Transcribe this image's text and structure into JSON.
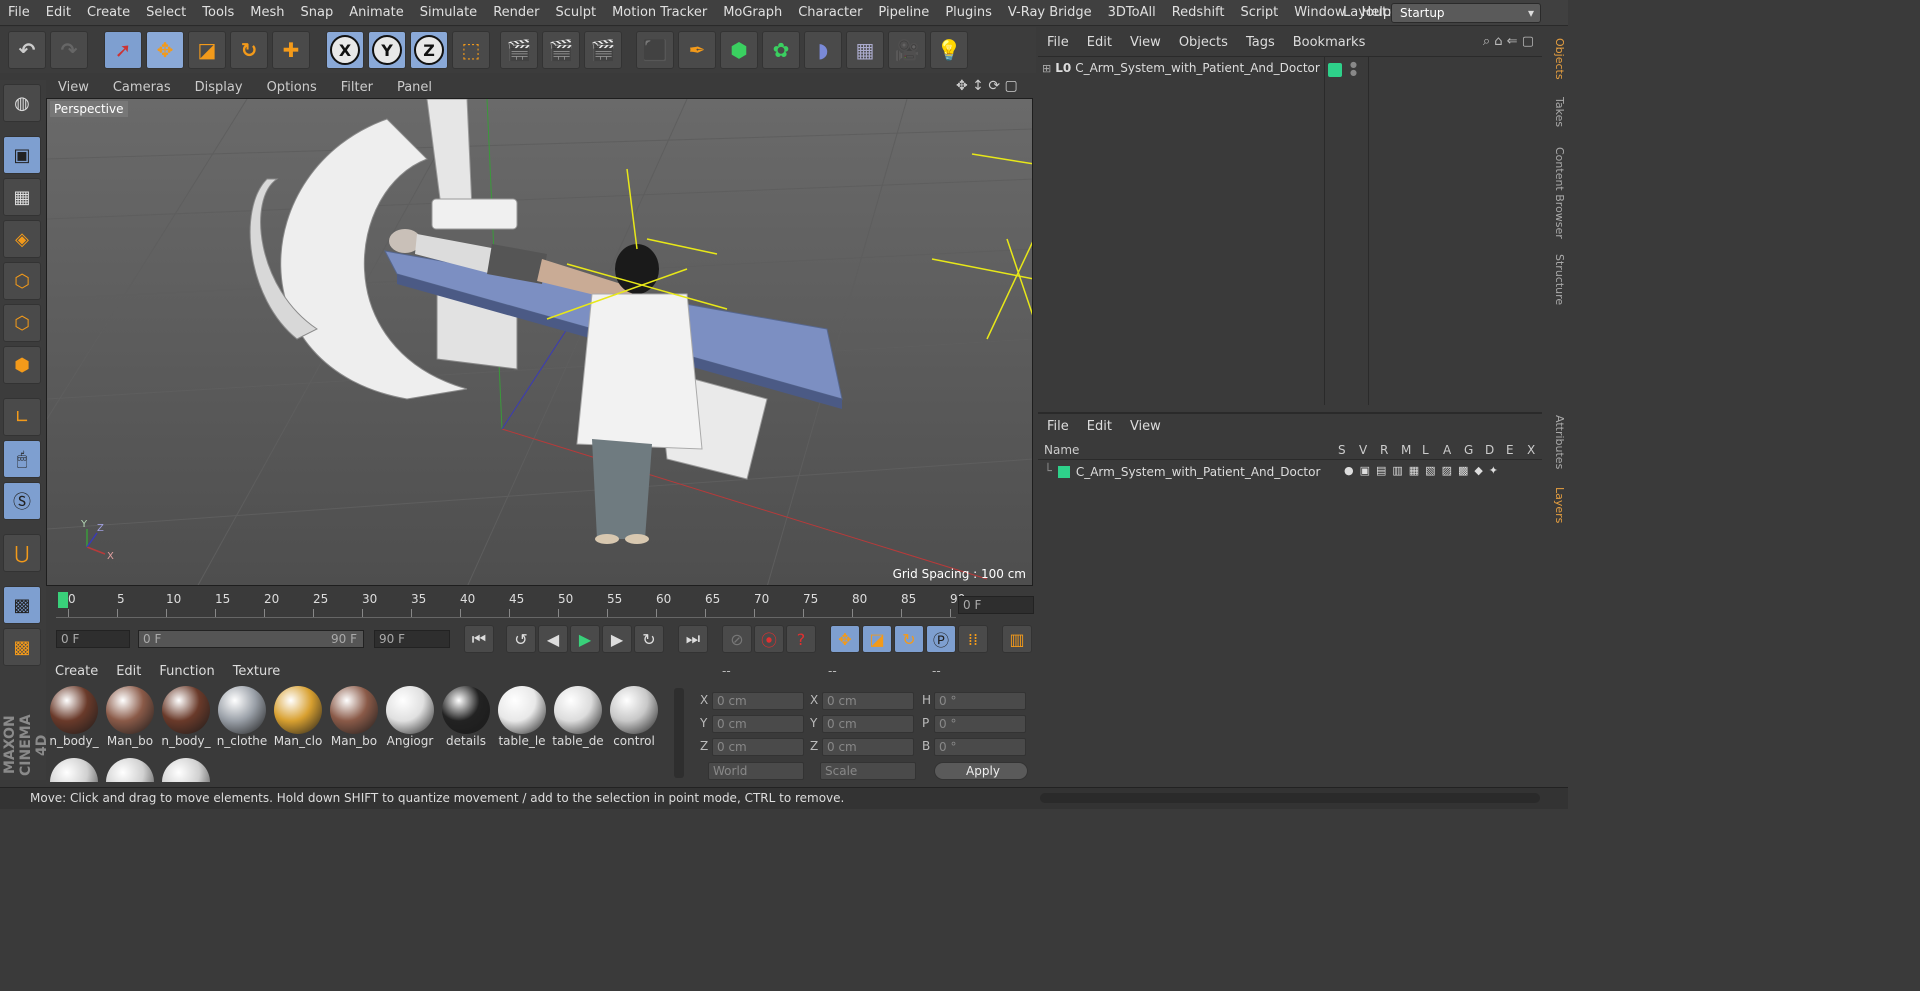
{
  "menu": [
    "File",
    "Edit",
    "Create",
    "Select",
    "Tools",
    "Mesh",
    "Snap",
    "Animate",
    "Simulate",
    "Render",
    "Sculpt",
    "Motion Tracker",
    "MoGraph",
    "Character",
    "Pipeline",
    "Plugins",
    "V-Ray Bridge",
    "3DToAll",
    "Redshift",
    "Script",
    "Window",
    "Help"
  ],
  "layout": {
    "label": "Layout:",
    "value": "Startup"
  },
  "viewport": {
    "menu": [
      "View",
      "Cameras",
      "Display",
      "Options",
      "Filter",
      "Panel"
    ],
    "label": "Perspective",
    "grid_spacing": "Grid Spacing : 100 cm"
  },
  "timeline": {
    "ticks": [
      "0",
      "5",
      "10",
      "15",
      "20",
      "25",
      "30",
      "35",
      "40",
      "45",
      "50",
      "55",
      "60",
      "65",
      "70",
      "75",
      "80",
      "85",
      "90"
    ],
    "current_frame": "0 F"
  },
  "transport": {
    "start": "0 F",
    "range_start": "0 F",
    "range_end": "90 F",
    "end": "90 F"
  },
  "materials": {
    "menu": [
      "Create",
      "Edit",
      "Function",
      "Texture"
    ],
    "items": [
      {
        "name": "n_body_",
        "color": "#6a3a2a"
      },
      {
        "name": "Man_bo",
        "color": "#8a5a48"
      },
      {
        "name": "n_body_",
        "color": "#6a3a2a"
      },
      {
        "name": "n_clothe",
        "color": "#9aa0a8"
      },
      {
        "name": "Man_clo",
        "color": "#d8a030"
      },
      {
        "name": "Man_bo",
        "color": "#8a5a48"
      },
      {
        "name": "Angiogr",
        "color": "#e0e0e0"
      },
      {
        "name": "details",
        "color": "#222222"
      },
      {
        "name": "table_le",
        "color": "#e8e8e8"
      },
      {
        "name": "table_de",
        "color": "#dcdcdc"
      },
      {
        "name": "control",
        "color": "#c8c8c8"
      }
    ]
  },
  "coords": {
    "headers": [
      "--",
      "--",
      "--"
    ],
    "rows": [
      {
        "a": "X",
        "av": "0 cm",
        "b": "X",
        "bv": "0 cm",
        "c": "H",
        "cv": "0 °"
      },
      {
        "a": "Y",
        "av": "0 cm",
        "b": "Y",
        "bv": "0 cm",
        "c": "P",
        "cv": "0 °"
      },
      {
        "a": "Z",
        "av": "0 cm",
        "b": "Z",
        "bv": "0 cm",
        "c": "B",
        "cv": "0 °"
      }
    ],
    "mode": "World",
    "scale": "Scale",
    "apply": "Apply"
  },
  "objects": {
    "menu": [
      "File",
      "Edit",
      "View",
      "Objects",
      "Tags",
      "Bookmarks"
    ],
    "item": "C_Arm_System_with_Patient_And_Doctor",
    "tag_color": "#2ed18a"
  },
  "layers": {
    "menu": [
      "File",
      "Edit",
      "View"
    ],
    "columns": [
      "Name",
      "S",
      "V",
      "R",
      "M",
      "L",
      "A",
      "G",
      "D",
      "E",
      "X"
    ],
    "item": "C_Arm_System_with_Patient_And_Doctor",
    "color": "#2ed18a"
  },
  "side_tabs": [
    "Objects",
    "Takes",
    "Content Browser",
    "Structure",
    "Attributes",
    "Layers"
  ],
  "status": "Move: Click and drag to move elements. Hold down SHIFT to quantize movement / add to the selection in point mode, CTRL to remove.",
  "logo": "MAXON CINEMA 4D"
}
